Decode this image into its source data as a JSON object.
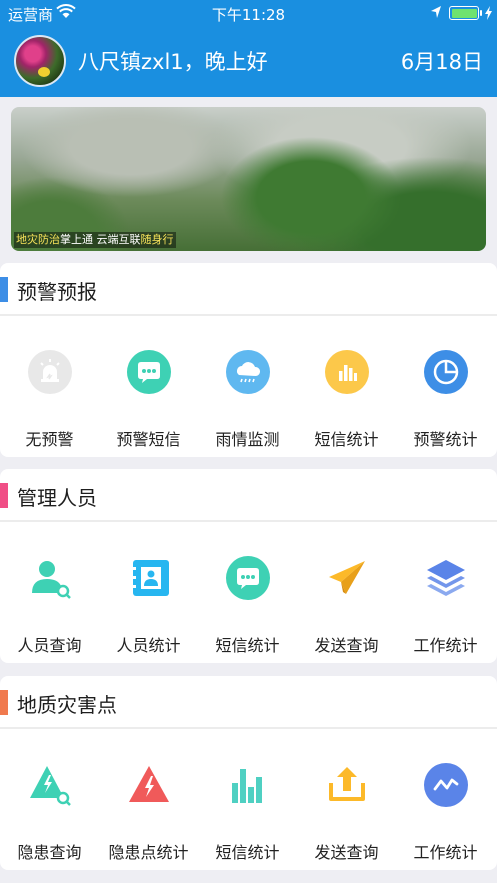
{
  "status_bar": {
    "carrier": "运营商",
    "time": "下午11:28"
  },
  "header": {
    "greeting": "八尺镇zxl1，晚上好",
    "date": "6月18日"
  },
  "banner": {
    "caption_parts": [
      {
        "text": "地灾防治",
        "highlight": true
      },
      {
        "text": "掌上通  云端互联",
        "highlight": false
      },
      {
        "text": "随身行",
        "highlight": true
      }
    ]
  },
  "sections": [
    {
      "title": "预警预报",
      "accent": "#3d8ee6",
      "items": [
        {
          "label": "无预警",
          "icon": "alarm-light-icon",
          "color": "#e8e8e8"
        },
        {
          "label": "预警短信",
          "icon": "chat-bubble-icon",
          "color": "#3ed1b4"
        },
        {
          "label": "雨情监测",
          "icon": "rain-cloud-icon",
          "color": "#5fb8f0"
        },
        {
          "label": "短信统计",
          "icon": "bar-chart-icon",
          "color": "#fcc84a"
        },
        {
          "label": "预警统计",
          "icon": "pie-chart-icon",
          "color": "#3d8ee6"
        }
      ]
    },
    {
      "title": "管理人员",
      "accent": "#f04e86",
      "items": [
        {
          "label": "人员查询",
          "icon": "person-search-icon",
          "color": "#3ed1b4"
        },
        {
          "label": "人员统计",
          "icon": "contact-book-icon",
          "color": "#27b6f0"
        },
        {
          "label": "短信统计",
          "icon": "chat-bubble-icon",
          "color": "#3ed1b4"
        },
        {
          "label": "发送查询",
          "icon": "paper-plane-icon",
          "color": "#fcb929"
        },
        {
          "label": "工作统计",
          "icon": "layers-icon",
          "color": "#5a84e8"
        }
      ]
    },
    {
      "title": "地质灾害点",
      "accent": "#f07a4e",
      "items": [
        {
          "label": "隐患查询",
          "icon": "hazard-search-icon",
          "color": "#3ed1b4"
        },
        {
          "label": "隐患点统计",
          "icon": "hazard-triangle-icon",
          "color": "#f05a5a"
        },
        {
          "label": "短信统计",
          "icon": "bar-chart-icon",
          "color": "#4fd0c2"
        },
        {
          "label": "发送查询",
          "icon": "upload-icon",
          "color": "#fcb929"
        },
        {
          "label": "工作统计",
          "icon": "trend-line-icon",
          "color": "#5a84e8"
        }
      ]
    }
  ]
}
